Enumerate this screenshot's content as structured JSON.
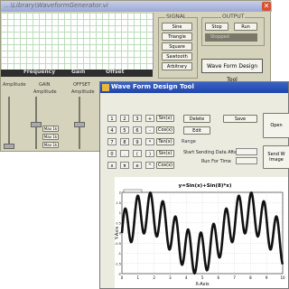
{
  "gen_window": {
    "title": "...\\Library\\WaveformGenerator.vi",
    "close_icon": "close-icon",
    "status": {
      "frequency_label": "Frequency",
      "gain_label": "Gain",
      "offset_label": "Offset"
    },
    "signal": {
      "label": "SIGNAL",
      "buttons": [
        "Sine",
        "Triangle",
        "Square",
        "Sawtooth",
        "Arbitrary"
      ]
    },
    "output": {
      "label": "OUTPUT",
      "stop_label": "Stop",
      "run_label": "Run",
      "status_value": "Stopped"
    },
    "design_tool_label": "Wave Form Design Tool",
    "lower": {
      "amplitude_label": "Amplitude",
      "gain_label": "GAIN",
      "offset_label": "OFFSET",
      "amp_left_label": "Amplitude",
      "amp_right_label": "Amplitude",
      "mini_buttons": [
        "Max 1k",
        "Max 1k",
        "Max 1k"
      ]
    }
  },
  "designer": {
    "title": "Wave Form Design Tool",
    "keypad": [
      [
        "1",
        "2",
        "3",
        "+"
      ],
      [
        "4",
        "5",
        "6",
        "-"
      ],
      [
        "7",
        "8",
        "9",
        "*"
      ],
      [
        "0",
        ".",
        "(",
        ")"
      ],
      [
        "x",
        "π",
        "e",
        "^"
      ]
    ],
    "functions": [
      "Sin(x)",
      "Cos(x)",
      "Tan(x)",
      "Sin(x)",
      "Cos(x)"
    ],
    "delete_label": "Delete",
    "save_label": "Save",
    "edit_label": "Edit",
    "range_label": "Range",
    "start_label": "Start Sending Data After",
    "run_for_label": "Run For Time",
    "open_label": "Open",
    "send_label": "Send W Image",
    "chart_title": "y=Sin(x)+Sin(8)*x)",
    "colors": {
      "wave": "#111111",
      "title_bar": "#2a52be"
    }
  },
  "chart_data": {
    "type": "line",
    "title": "y=Sin(x)+Sin(8)*x)",
    "xlabel": "X-Axis",
    "ylabel": "Y-Axis",
    "xlim": [
      0,
      10
    ],
    "ylim": [
      -2,
      2
    ],
    "xticks": [
      "0",
      "1",
      "2",
      "3",
      "4",
      "5",
      "6",
      "7",
      "8",
      "9",
      "10"
    ],
    "yticks": [
      "2",
      "1.5",
      "1",
      "0.5",
      "0",
      "-0.5",
      "-1",
      "-1.5",
      "-2"
    ],
    "series": [
      {
        "function": "sin(x)+sin(8x)"
      }
    ]
  }
}
